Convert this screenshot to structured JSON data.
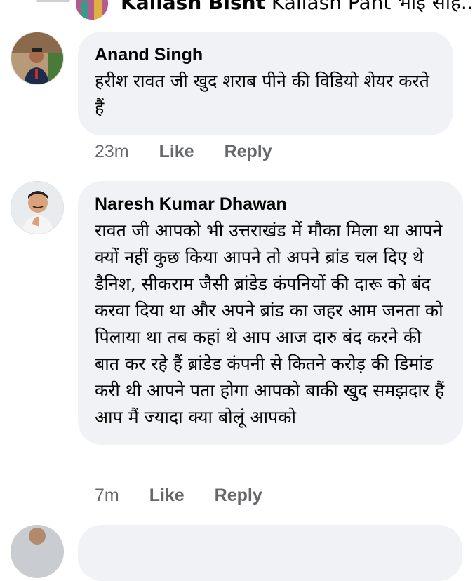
{
  "previous_reply": {
    "author": "Kailash Bisht",
    "text_preview": "Kailash Pant भाइ साह..."
  },
  "comments": [
    {
      "author": "Anand Singh",
      "text": "हरीश रावत जी खुद शराब पीने की विडियो शेयर करते हैं",
      "time": "23m",
      "like_label": "Like",
      "reply_label": "Reply"
    },
    {
      "author": "Naresh Kumar Dhawan",
      "text": "रावत जी आपको भी उत्तराखंड में मौका मिला था आपने क्यों नहीं कुछ किया आपने तो अपने ब्रांड चल दिए थे डैनिश, सीकराम जैसी ब्रांडेड कंपनियों की दारू को बंद करवा दिया था और अपने ब्रांड का जहर आम जनता को पिलाया था तब कहां थे आप आज दारु बंद करने की बात कर रहे हैं ब्रांडेड कंपनी से कितने करोड़ की डिमांड करी थी आपने पता होगा आपको बाकी खुद समझदार हैं आप मैं ज्यादा क्या बोलूं आपको",
      "time": "7m",
      "like_label": "Like",
      "reply_label": "Reply"
    }
  ],
  "colors": {
    "bubble_bg": "#f0f2f5",
    "secondary_text": "#65676b",
    "primary_text": "#050505"
  }
}
